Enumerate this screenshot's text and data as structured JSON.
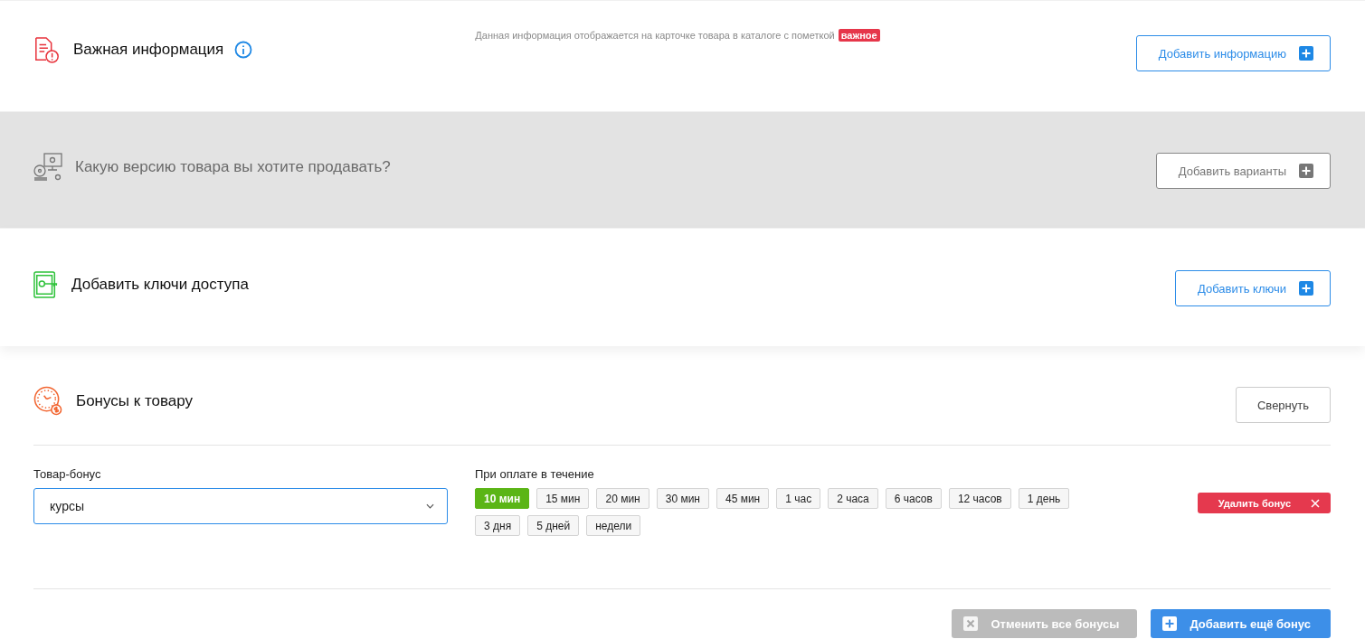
{
  "important": {
    "title": "Важная информация",
    "note": "Данная информация отображается на карточке товара в каталоге с пометкой",
    "note_badge": "важное",
    "button": "Добавить информацию"
  },
  "versions": {
    "title": "Какую версию товара вы хотите продавать?",
    "button": "Добавить варианты",
    "disabled": true
  },
  "keys": {
    "title": "Добавить ключи доступа",
    "button": "Добавить ключи"
  },
  "bonuses": {
    "title": "Бонусы к товару",
    "collapse_button": "Свернуть",
    "items": [
      {
        "product_label": "Товар-бонус",
        "product_value": "курсы",
        "period_label": "При оплате в течение",
        "delete_button": "Удалить бонус",
        "periods": [
          {
            "label": "10 мин",
            "selected": true
          },
          {
            "label": "15 мин",
            "selected": false
          },
          {
            "label": "20 мин",
            "selected": false
          },
          {
            "label": "30 мин",
            "selected": false
          },
          {
            "label": "45 мин",
            "selected": false
          },
          {
            "label": "1 час",
            "selected": false
          },
          {
            "label": "2 часа",
            "selected": false
          },
          {
            "label": "6 часов",
            "selected": false
          },
          {
            "label": "12 часов",
            "selected": false
          },
          {
            "label": "1 день",
            "selected": false
          },
          {
            "label": "3 дня",
            "selected": false
          },
          {
            "label": "5 дней",
            "selected": false
          },
          {
            "label": "недели",
            "selected": false
          }
        ]
      }
    ],
    "cancel_button": {
      "label": "Отменить все бонусы",
      "disabled": true
    },
    "add_button": "Добавить ещё бонус"
  }
}
